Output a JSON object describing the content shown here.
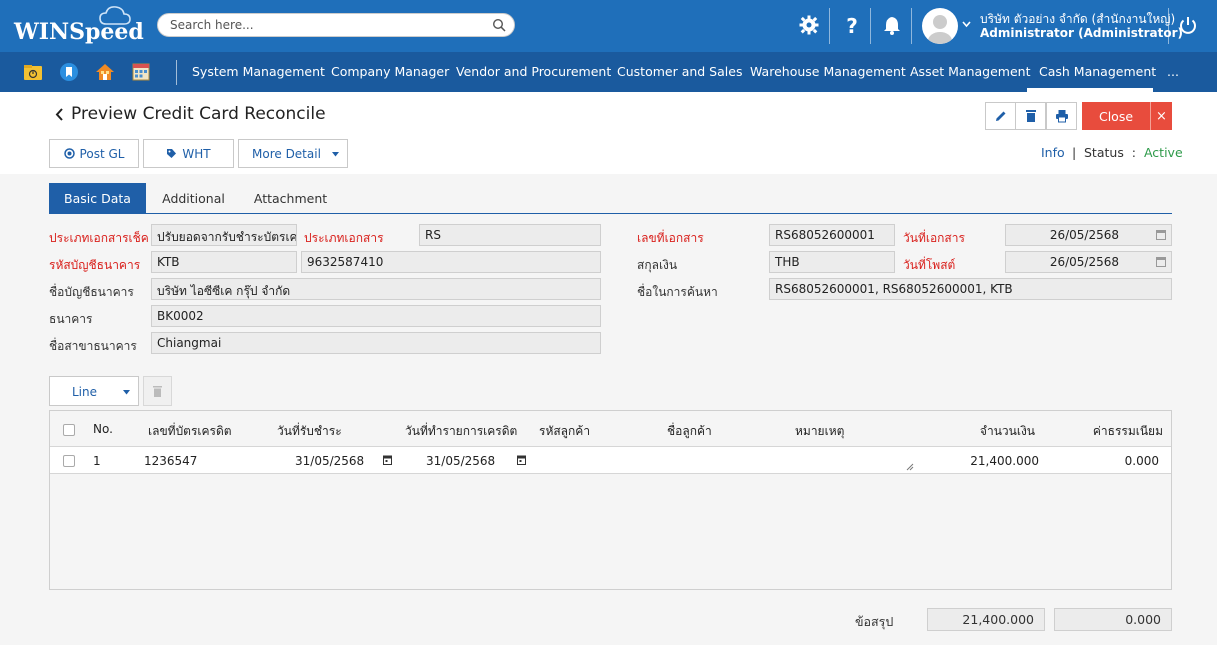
{
  "app": {
    "logo_text": "WINSpeed"
  },
  "search": {
    "placeholder": "Search here..."
  },
  "user": {
    "name": "บริษัท ตัวอย่าง จำกัด (สำนักงานใหญ่)",
    "role": "Administrator (Administrator)"
  },
  "nav": {
    "items": [
      "System Management",
      "Company Manager",
      "Vendor and Procurement",
      "Customer and Sales",
      "Warehouse Management",
      "Asset Management",
      "Cash Management",
      "..."
    ]
  },
  "page": {
    "title": "Preview Credit Card Reconcile",
    "close_label": "Close",
    "close_x": "×"
  },
  "actions": {
    "post_gl": "Post GL",
    "wht": "WHT",
    "more_detail": "More Detail"
  },
  "status": {
    "info": "Info",
    "sep": "|",
    "label": "Status",
    "colon": ":",
    "value": "Active"
  },
  "tabs": [
    "Basic Data",
    "Additional",
    "Attachment"
  ],
  "form": {
    "doc_type_cheque_label": "ประเภทเอกสารเช็ค",
    "doc_type_cheque_value": "ปรับยอดจากรับชำระบัตรเครดิต",
    "doc_type_label": "ประเภทเอกสาร",
    "doc_type_value": "RS",
    "bank_account_code_label": "รหัสบัญชีธนาคาร",
    "bank_account_code_value": "KTB",
    "bank_account_no_value": "9632587410",
    "bank_account_name_label": "ชื่อบัญชีธนาคาร",
    "bank_account_name_value": "บริษัท ไอซีซีเค กรุ๊ป จำกัด",
    "bank_label": "ธนาคาร",
    "bank_value": "BK0002",
    "branch_label": "ชื่อสาขาธนาคาร",
    "branch_value": "Chiangmai",
    "doc_no_label": "เลขที่เอกสาร",
    "doc_no_value": "RS68052600001",
    "doc_date_label": "วันที่เอกสาร",
    "doc_date_value": "26/05/2568",
    "currency_label": "สกุลเงิน",
    "currency_value": "THB",
    "post_date_label": "วันที่โพสต์",
    "post_date_value": "26/05/2568",
    "search_name_label": "ชื่อในการค้นหา",
    "search_name_value": "RS68052600001, RS68052600001, KTB"
  },
  "lines": {
    "line_btn": "Line",
    "headers": [
      "No.",
      "เลขที่บัตรเครดิต",
      "วันที่รับชำระ",
      "วันที่ทำรายการเครดิต",
      "รหัสลูกค้า",
      "ชื่อลูกค้า",
      "หมายเหตุ",
      "จำนวนเงิน",
      "ค่าธรรมเนียม"
    ],
    "rows": [
      {
        "no": "1",
        "card_no": "1236547",
        "pay_date": "31/05/2568",
        "trans_date": "31/05/2568",
        "cust_code": "",
        "cust_name": "",
        "remark": "",
        "amount": "21,400.000",
        "fee": "0.000"
      }
    ]
  },
  "summary": {
    "label": "ข้อสรุป",
    "amount": "21,400.000",
    "fee": "0.000"
  },
  "colors": {
    "header": "#1f6fba",
    "nav": "#1a5a9e",
    "accent": "#1f5fa8",
    "close": "#e84c3d",
    "active_status": "#2e9a4a",
    "required_label": "#d9201c"
  }
}
